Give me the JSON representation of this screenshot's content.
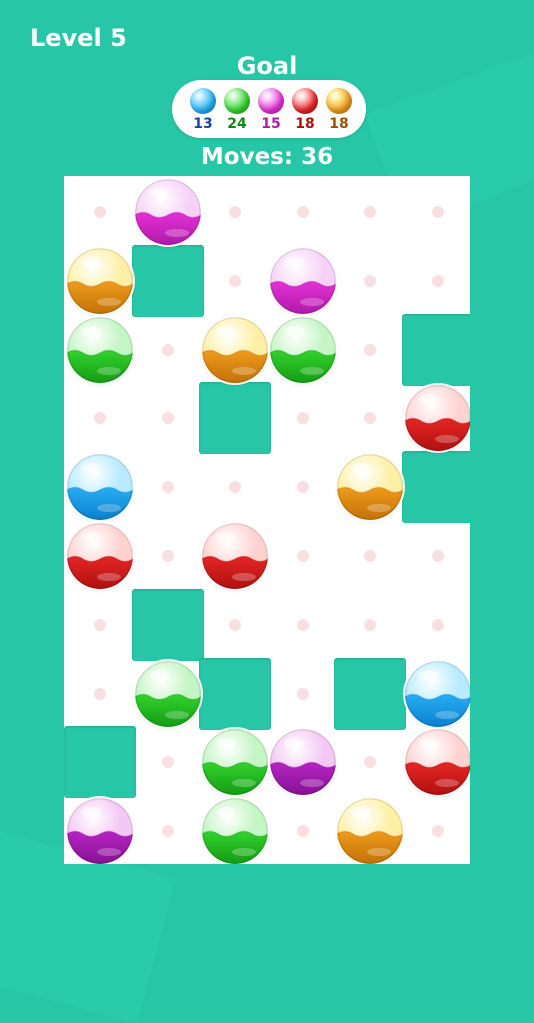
{
  "header": {
    "level_label": "Level 5",
    "goal_title": "Goal",
    "moves_label": "Moves: 36"
  },
  "colors": {
    "blue": {
      "top": "#b8ebff",
      "fill": "#27aef0",
      "dark": "#0b7fd0"
    },
    "green": {
      "top": "#c4f5c4",
      "fill": "#33d12e",
      "dark": "#149c14"
    },
    "pink": {
      "top": "#f6d2f6",
      "fill": "#e331d6",
      "dark": "#b01aa8"
    },
    "red": {
      "top": "#ffd2d2",
      "fill": "#e52626",
      "dark": "#b01010"
    },
    "orange": {
      "top": "#fdf0a6",
      "fill": "#ef9b1c",
      "dark": "#c27208"
    },
    "purple": {
      "top": "#f4c8f4",
      "fill": "#b524c2",
      "dark": "#851294"
    }
  },
  "goals": [
    {
      "color": "blue",
      "count": "13",
      "count_color": "#17479e"
    },
    {
      "color": "green",
      "count": "24",
      "count_color": "#0f8a17"
    },
    {
      "color": "pink",
      "count": "15",
      "count_color": "#b31aa6"
    },
    {
      "color": "red",
      "count": "18",
      "count_color": "#b0120d"
    },
    {
      "color": "orange",
      "count": "18",
      "count_color": "#9a5207"
    }
  ],
  "grid": {
    "cols": 6,
    "rows": 10
  },
  "blocks": [
    [
      1,
      1
    ],
    [
      5,
      2
    ],
    [
      2,
      3
    ],
    [
      5,
      4
    ],
    [
      1,
      6
    ],
    [
      2,
      7
    ],
    [
      4,
      7
    ],
    [
      0,
      8
    ]
  ],
  "balls": [
    {
      "col": 1,
      "row": 0,
      "color": "pink"
    },
    {
      "col": 0,
      "row": 1,
      "color": "orange"
    },
    {
      "col": 3,
      "row": 1,
      "color": "pink"
    },
    {
      "col": 0,
      "row": 2,
      "color": "green"
    },
    {
      "col": 2,
      "row": 2,
      "color": "orange"
    },
    {
      "col": 3,
      "row": 2,
      "color": "green"
    },
    {
      "col": 5,
      "row": 3,
      "color": "red"
    },
    {
      "col": 0,
      "row": 4,
      "color": "blue"
    },
    {
      "col": 4,
      "row": 4,
      "color": "orange"
    },
    {
      "col": 0,
      "row": 5,
      "color": "red"
    },
    {
      "col": 2,
      "row": 5,
      "color": "red"
    },
    {
      "col": 1,
      "row": 7,
      "color": "green"
    },
    {
      "col": 5,
      "row": 7,
      "color": "blue"
    },
    {
      "col": 2,
      "row": 8,
      "color": "green"
    },
    {
      "col": 3,
      "row": 8,
      "color": "purple"
    },
    {
      "col": 5,
      "row": 8,
      "color": "red"
    },
    {
      "col": 0,
      "row": 9,
      "color": "purple"
    },
    {
      "col": 2,
      "row": 9,
      "color": "green"
    },
    {
      "col": 4,
      "row": 9,
      "color": "orange"
    }
  ]
}
